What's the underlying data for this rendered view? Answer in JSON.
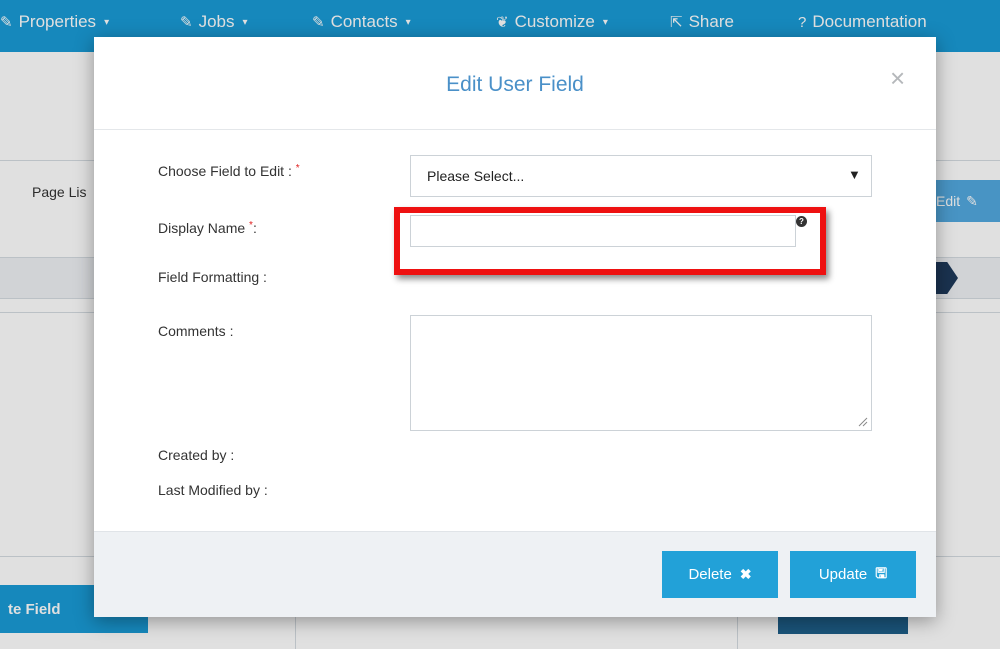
{
  "navbar": {
    "items": [
      {
        "icon": "pencil-square-icon",
        "glyph": "✎",
        "label": "Properties",
        "caret": "▾"
      },
      {
        "icon": "pencil-square-icon",
        "glyph": "✎",
        "label": "Jobs",
        "caret": "▾"
      },
      {
        "icon": "pencil-square-icon",
        "glyph": "✎",
        "label": "Contacts",
        "caret": "▾"
      },
      {
        "icon": "leaf-icon",
        "glyph": "❦",
        "label": "Customize",
        "caret": "▾"
      },
      {
        "icon": "share-icon",
        "glyph": "⇱",
        "label": "Share",
        "caret": ""
      },
      {
        "icon": "question-circle-icon",
        "glyph": "?",
        "label": "Documentation",
        "caret": ""
      }
    ],
    "color": "#1a9bd6"
  },
  "background": {
    "page_list_label": "Page Lis",
    "edit_button_label": "Edit",
    "create_field_button_label": "te Field"
  },
  "modal": {
    "title": "Edit User Field",
    "close_glyph": "×",
    "fields": {
      "choose_field_label": "Choose Field to Edit :",
      "choose_field_required": "*",
      "choose_field_value": "Please Select...",
      "display_name_label": "Display Name",
      "display_name_required": "*",
      "display_name_suffix": ":",
      "display_name_value": "",
      "field_formatting_label": "Field Formatting :",
      "comments_label": "Comments :",
      "comments_value": "",
      "created_by_label": "Created by :",
      "last_modified_by_label": "Last Modified by :"
    },
    "buttons": {
      "delete_label": "Delete",
      "delete_glyph": "✖",
      "update_label": "Update",
      "update_glyph": "🖫"
    },
    "accent_color": "#22a1d8",
    "highlight_color": "#ee1111"
  }
}
